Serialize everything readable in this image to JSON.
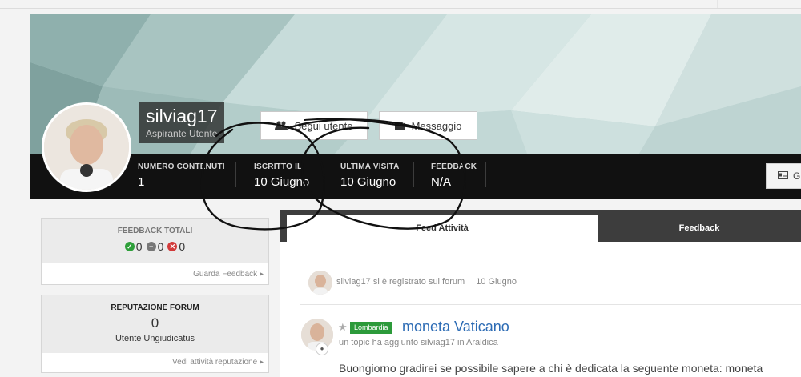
{
  "profile": {
    "username": "silviag17",
    "rank": "Aspirante Utente",
    "follow_label": "Segui utente",
    "message_label": "Messaggio",
    "right_button_label": "G"
  },
  "stats": [
    {
      "label": "NUMERO CONTENUTI",
      "value": "1"
    },
    {
      "label": "ISCRITTO IL",
      "value": "10 Giugno"
    },
    {
      "label": "ULTIMA VISITA",
      "value": "10 Giugno"
    },
    {
      "label": "FEEDBACK",
      "value": "N/A"
    }
  ],
  "feedback_panel": {
    "title": "FEEDBACK TOTALI",
    "positive": "0",
    "neutral": "0",
    "negative": "0",
    "link": "Guarda Feedback"
  },
  "reputation_panel": {
    "title": "REPUTAZIONE FORUM",
    "value": "0",
    "level": "Utente Ungiudicatus",
    "link": "Vedi attività reputazione"
  },
  "tabs": [
    {
      "label": "Feed Attività",
      "active": true
    },
    {
      "label": "Feedback",
      "active": false
    }
  ],
  "activity": {
    "registered_text": "silviag17 si è registrato sul forum",
    "registered_time": "10 Giugno",
    "topic_tag": "Lombardia",
    "topic_title": "moneta Vaticano",
    "topic_sub": "un topic ha aggiunto silviag17 in Araldica",
    "topic_body": "Buongiorno gradirei se possibile sapere a chi è dedicata la seguente moneta: moneta"
  },
  "icons": {
    "follow": "users-icon",
    "message": "envelope-icon",
    "positive": "check-circle-icon",
    "neutral": "minus-circle-icon",
    "negative": "x-circle-icon",
    "featured": "star-icon",
    "comment": "comment-icon"
  },
  "colors": {
    "accent_blue": "#2d6cb5",
    "tag_green": "#2c9a3a",
    "positive": "#2e9f3a",
    "neutral": "#777777",
    "negative": "#d23a3a",
    "stat_bar": "#111111"
  }
}
